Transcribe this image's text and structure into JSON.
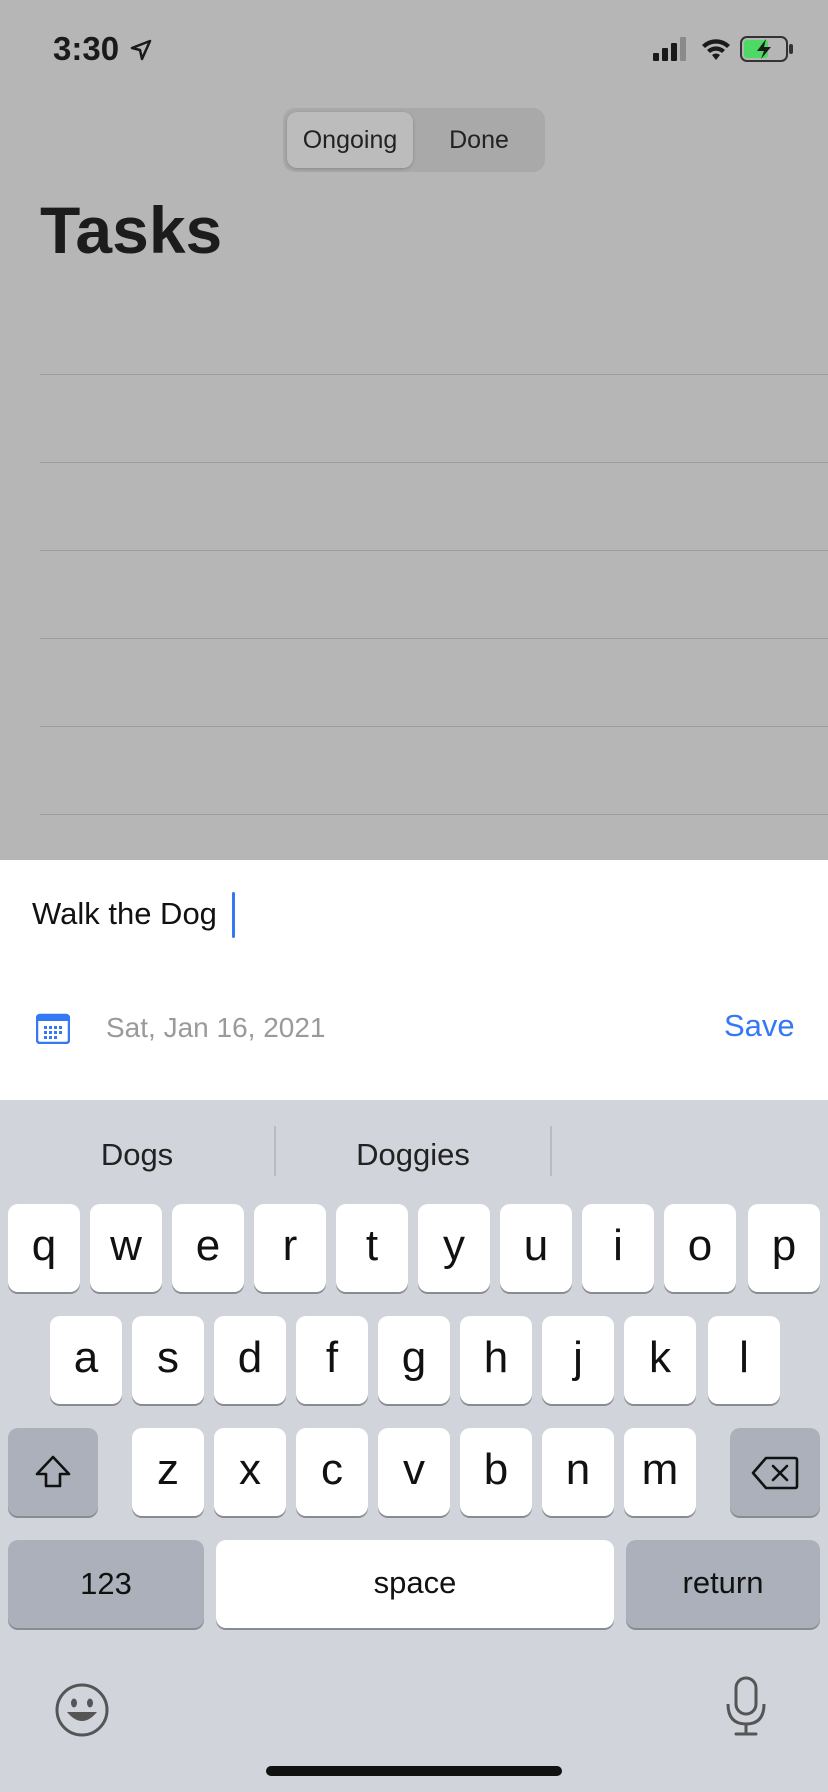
{
  "status_bar": {
    "time": "3:30",
    "icons": [
      "location-arrow-icon",
      "cellular-signal-icon",
      "wifi-icon",
      "battery-charging-icon"
    ]
  },
  "segmented": {
    "options": [
      "Ongoing",
      "Done"
    ],
    "selected": "Ongoing"
  },
  "page": {
    "title": "Tasks"
  },
  "task_sheet": {
    "task_value": "Walk the Dog",
    "date": "Sat, Jan 16, 2021",
    "save_label": "Save",
    "accent_color": "#3478f6"
  },
  "keyboard": {
    "suggestions": [
      "Dogs",
      "Doggies",
      ""
    ],
    "row1": [
      "q",
      "w",
      "e",
      "r",
      "t",
      "y",
      "u",
      "i",
      "o",
      "p"
    ],
    "row2": [
      "a",
      "s",
      "d",
      "f",
      "g",
      "h",
      "j",
      "k",
      "l"
    ],
    "row3": [
      "z",
      "x",
      "c",
      "v",
      "b",
      "n",
      "m"
    ],
    "numbers_label": "123",
    "space_label": "space",
    "return_label": "return",
    "icons": [
      "shift-icon",
      "backspace-icon",
      "emoji-icon",
      "microphone-icon"
    ]
  }
}
